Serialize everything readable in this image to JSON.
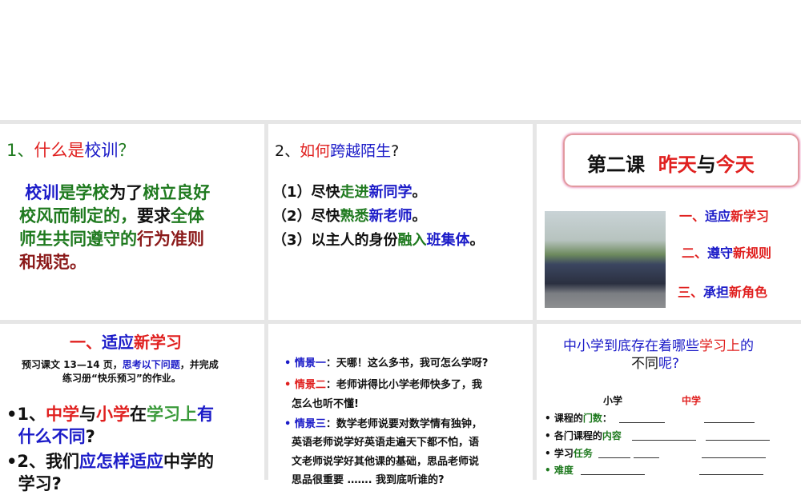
{
  "panel1": {
    "title": [
      {
        "t": "1、",
        "c": "g"
      },
      {
        "t": "什么是",
        "c": "r"
      },
      {
        "t": "校训",
        "c": "b"
      },
      {
        "t": "？",
        "c": "g"
      }
    ],
    "body": [
      [
        {
          "t": " 校训",
          "c": "b"
        },
        {
          "t": "是学校",
          "c": "g"
        },
        {
          "t": "为了",
          "c": "k"
        },
        {
          "t": "树立良好",
          "c": "g"
        }
      ],
      [
        {
          "t": "校风而制定的，",
          "c": "g"
        },
        {
          "t": "要求",
          "c": "k"
        },
        {
          "t": "全体",
          "c": "g"
        }
      ],
      [
        {
          "t": "师生共同遵守的",
          "c": "g"
        },
        {
          "t": "行为准则",
          "c": "d"
        }
      ],
      [
        {
          "t": "和规范。",
          "c": "d"
        }
      ]
    ]
  },
  "panel2": {
    "title": [
      {
        "t": "2、",
        "c": "k"
      },
      {
        "t": "如何",
        "c": "r"
      },
      {
        "t": "跨越陌生",
        "c": "b"
      },
      {
        "t": "?",
        "c": "k"
      }
    ],
    "items": [
      [
        {
          "t": "（1）尽快",
          "c": "k"
        },
        {
          "t": "走进",
          "c": "g"
        },
        {
          "t": "新同学",
          "c": "b"
        },
        {
          "t": "。",
          "c": "k"
        }
      ],
      [
        {
          "t": "（2）尽快",
          "c": "k"
        },
        {
          "t": "熟悉",
          "c": "g"
        },
        {
          "t": "新老师",
          "c": "b"
        },
        {
          "t": "。",
          "c": "k"
        }
      ],
      [
        {
          "t": "（3）以主人的身份",
          "c": "k"
        },
        {
          "t": "融入",
          "c": "g"
        },
        {
          "t": "班集体",
          "c": "b"
        },
        {
          "t": "。",
          "c": "k"
        }
      ]
    ]
  },
  "panel3": {
    "title": [
      {
        "t": "第二课  ",
        "c": "k"
      },
      {
        "t": "昨天",
        "c": "r"
      },
      {
        "t": "与",
        "c": "k"
      },
      {
        "t": "今天",
        "c": "r"
      }
    ],
    "items": [
      [
        {
          "t": "一、",
          "c": "r"
        },
        {
          "t": "适应",
          "c": "b"
        },
        {
          "t": "新学习",
          "c": "r"
        }
      ],
      [
        {
          "t": "二、",
          "c": "r"
        },
        {
          "t": "遵守",
          "c": "b"
        },
        {
          "t": "新规则",
          "c": "r"
        }
      ],
      [
        {
          "t": "三、",
          "c": "r"
        },
        {
          "t": "承担",
          "c": "b"
        },
        {
          "t": "新角色",
          "c": "r"
        }
      ]
    ]
  },
  "panel4": {
    "title": [
      {
        "t": "一、",
        "c": "r"
      },
      {
        "t": "适应",
        "c": "b"
      },
      {
        "t": "新学习",
        "c": "r"
      }
    ],
    "intro1": [
      {
        "t": "预习课文 13—14 页，",
        "c": "k"
      },
      {
        "t": "思考以下问题",
        "c": "b"
      },
      {
        "t": "，并完成",
        "c": "k"
      }
    ],
    "intro2": [
      {
        "t": "练习册“快乐预习”的作业。",
        "c": "k"
      }
    ],
    "q": [
      [
        {
          "t": "•1、",
          "c": "k"
        },
        {
          "t": "中学",
          "c": "r"
        },
        {
          "t": "与",
          "c": "k"
        },
        {
          "t": "小学",
          "c": "r"
        },
        {
          "t": "在",
          "c": "k"
        },
        {
          "t": "学习上",
          "c": "lg"
        },
        {
          "t": "有",
          "c": "b"
        }
      ],
      [
        {
          "t": "  什么不同",
          "c": "b"
        },
        {
          "t": "?",
          "c": "k"
        }
      ],
      [
        {
          "t": "•2、我们",
          "c": "k"
        },
        {
          "t": "应怎样适应",
          "c": "b"
        },
        {
          "t": "中学的",
          "c": "k"
        }
      ],
      [
        {
          "t": "  学习?",
          "c": "k"
        }
      ]
    ]
  },
  "panel5": {
    "lines": [
      [
        {
          "t": "• ",
          "c": "b"
        },
        {
          "t": "情景一",
          "c": "b"
        },
        {
          "t": "：天哪！这么多书，我可怎么学呀?",
          "c": "k"
        }
      ],
      [
        {
          "t": "• ",
          "c": "r"
        },
        {
          "t": "情景二",
          "c": "r"
        },
        {
          "t": "：老师讲得比小学老师快多了，我",
          "c": "k"
        }
      ],
      [
        {
          "t": "  怎么也听不懂!",
          "c": "k"
        }
      ],
      [
        {
          "t": "• ",
          "c": "b"
        },
        {
          "t": "情景三",
          "c": "b"
        },
        {
          "t": "：数学老师说要对数学情有独钟，",
          "c": "k"
        }
      ],
      [
        {
          "t": "  英语老师说学好英语走遍天下都不怕，语",
          "c": "k"
        }
      ],
      [
        {
          "t": "  文老师说学好其他课的基础，思品老师说",
          "c": "k"
        }
      ],
      [
        {
          "t": "  思品很重要 ……. 我到底听谁的?",
          "c": "k"
        }
      ]
    ]
  },
  "panel6": {
    "title1": [
      {
        "t": "中小学到底存在着哪些",
        "c": "b"
      },
      {
        "t": "学习上",
        "c": "r"
      },
      {
        "t": "的",
        "c": "b"
      }
    ],
    "title2": [
      {
        "t": "不同",
        "c": "k"
      },
      {
        "t": "呢?",
        "c": "b"
      }
    ],
    "col_primary": "小学",
    "col_middle": "中学",
    "rows": [
      [
        {
          "t": "• 课程的",
          "c": "k"
        },
        {
          "t": "门数",
          "c": "g"
        },
        {
          "t": "：",
          "c": "k"
        }
      ],
      [
        {
          "t": "• 各门课程的",
          "c": "k"
        },
        {
          "t": "内容",
          "c": "g"
        }
      ],
      [
        {
          "t": "• 学习",
          "c": "k"
        },
        {
          "t": "任务",
          "c": "g"
        }
      ],
      [
        {
          "t": "• 难度",
          "c": "g"
        }
      ]
    ]
  }
}
